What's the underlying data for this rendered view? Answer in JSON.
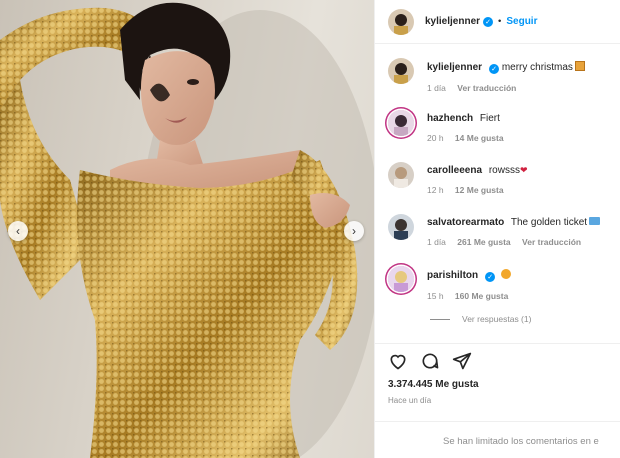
{
  "post": {
    "username": "kylieljenner",
    "follow_label": "Seguir",
    "separator": "•",
    "caption": "merry christmas",
    "caption_time": "1 día",
    "caption_translate": "Ver traducción",
    "accent_color": "#0095f6"
  },
  "comments": [
    {
      "user": "hazhench",
      "text": "Fiert",
      "time": "20 h",
      "likes": "14 Me gusta",
      "translate": ""
    },
    {
      "user": "carolleeena",
      "text": "rowsss",
      "time": "12 h",
      "likes": "12 Me gusta",
      "translate": ""
    },
    {
      "user": "salvatorearmato",
      "text": "The golden ticket",
      "time": "1 día",
      "likes": "261 Me gusta",
      "translate": "Ver traducción"
    },
    {
      "user": "parishilton",
      "text": "",
      "time": "15 h",
      "likes": "160 Me gusta",
      "translate": ""
    }
  ],
  "replies_label": "Ver respuestas (1)",
  "footer": {
    "likes": "3.374.445 Me gusta",
    "time": "Hace un día",
    "limited": "Se han limitado los comentarios en e"
  },
  "icons": {
    "like": "heart-icon",
    "comment": "comment-icon",
    "share": "send-icon",
    "prev": "chevron-left-icon",
    "next": "chevron-right-icon"
  }
}
